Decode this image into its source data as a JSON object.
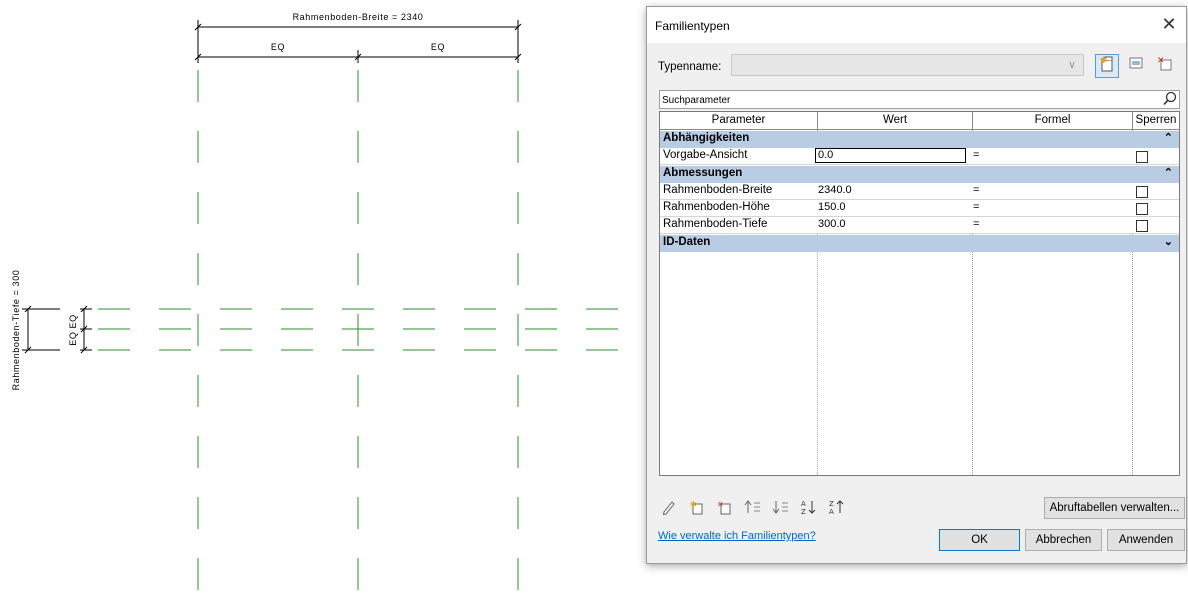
{
  "drawing": {
    "width_dimension": "Rahmenboden-Breite = 2340",
    "eq_left": "EQ",
    "eq_right": "EQ",
    "depth_dimension": "Rahmenboden-Tiefe = 300",
    "eq_vertical": "EQ EQ",
    "line_color": "#2e8b2e"
  },
  "dialog": {
    "title": "Familientypen",
    "close_glyph": "✕",
    "typename_label": "Typenname:",
    "typename_value": "",
    "toolbar_icons": [
      "new-type-icon",
      "rename-type-icon",
      "delete-type-icon"
    ],
    "search_placeholder": "Suchparameter",
    "columns": [
      "Parameter",
      "Wert",
      "Formel",
      "Sperren"
    ],
    "groups": [
      {
        "name": "Abhängigkeiten",
        "chevron": "⌃",
        "rows": [
          {
            "name": "Vorgabe-Ansicht",
            "value": "0.0",
            "formula": "=",
            "locked": false
          }
        ]
      },
      {
        "name": "Abmessungen",
        "chevron": "⌃",
        "rows": [
          {
            "name": "Rahmenboden-Breite",
            "value": "2340.0",
            "formula": "=",
            "locked": false
          },
          {
            "name": "Rahmenboden-Höhe",
            "value": "150.0",
            "formula": "=",
            "locked": false
          },
          {
            "name": "Rahmenboden-Tiefe",
            "value": "300.0",
            "formula": "=",
            "locked": false
          }
        ]
      },
      {
        "name": "ID-Daten",
        "chevron": "⌄",
        "rows": []
      }
    ],
    "bottom_icons": [
      "edit-pencil-icon",
      "new-parameter-icon",
      "delete-parameter-icon",
      "move-up-icon",
      "move-down-icon",
      "sort-ascending-icon",
      "sort-descending-icon"
    ],
    "lookup_button": "Abruftabellen verwalten...",
    "help_link": "Wie verwalte ich Familientypen?",
    "ok_button": "OK",
    "cancel_button": "Abbrechen",
    "apply_button": "Anwenden",
    "accent_color": "#0078d7",
    "group_color": "#b8cde4"
  }
}
